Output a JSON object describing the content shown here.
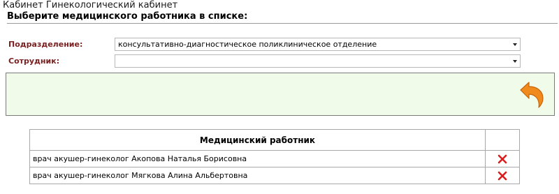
{
  "app": {
    "title": "Кабинет Гинекологический кабинет"
  },
  "section": {
    "title": "Выберите медицинского работника в списке:"
  },
  "filters": {
    "department_label": "Подразделение:",
    "department_value": "консультативно-диагностическое поликлиническое отделение",
    "employee_label": "Сотрудник:",
    "employee_value": ""
  },
  "icons": {
    "back": "undo-arrow-icon",
    "delete": "red-x-delete-icon"
  },
  "colors": {
    "label": "#7a1f1f",
    "panel_bg": "#f1fbea",
    "back_arrow": "#f08a1c",
    "delete": "#d81e1e"
  },
  "table": {
    "headers": [
      "Медицинский работник",
      ""
    ],
    "rows": [
      {
        "name": "врач акушер-гинеколог Акопова Наталья Борисовна"
      },
      {
        "name": "врач акушер-гинеколог Мягкова Алина Альбертовна"
      }
    ]
  }
}
